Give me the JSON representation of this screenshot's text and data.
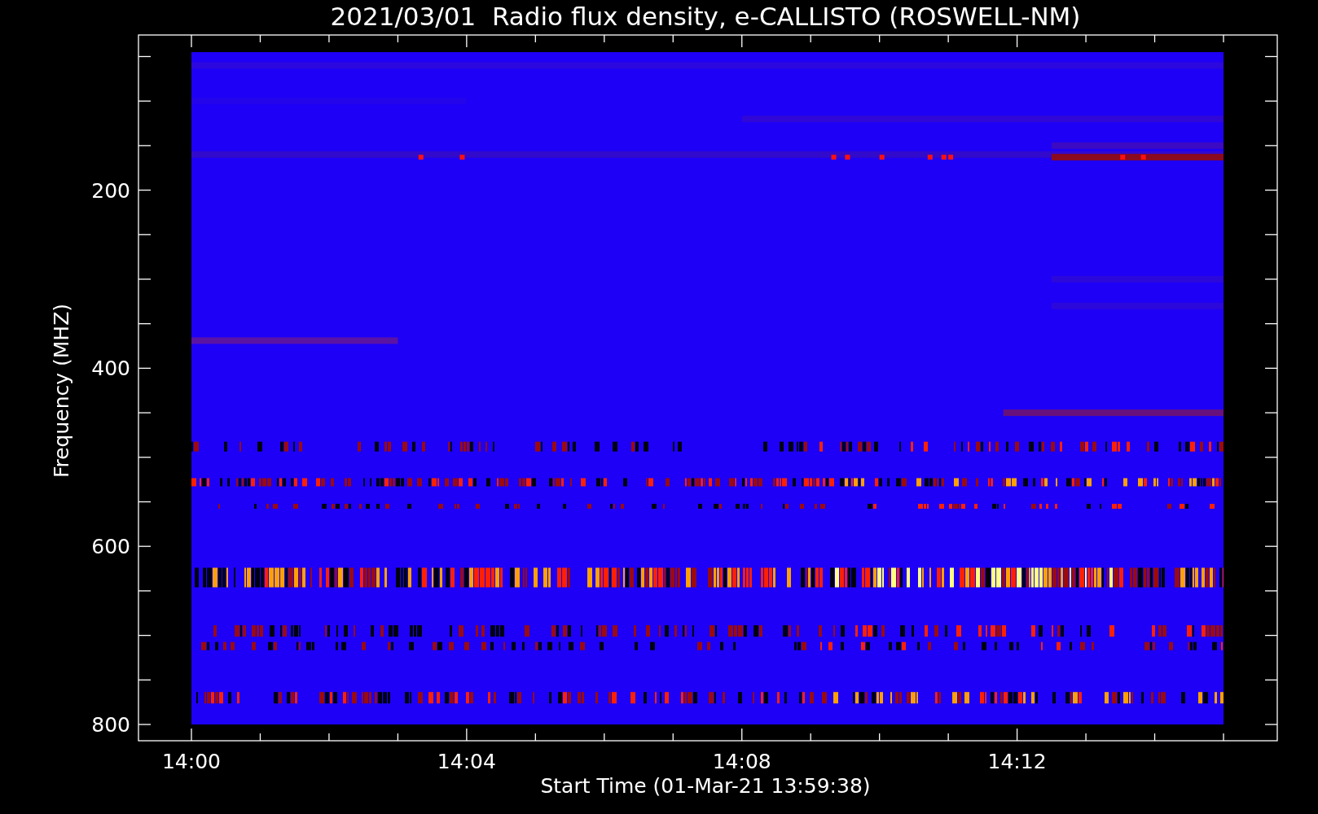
{
  "plot": {
    "title": "2021/03/01  Radio flux density, e-CALLISTO (ROSWELL-NM)",
    "y_axis": {
      "label": "Frequency (MHZ)",
      "tick_labels": [
        "200",
        "400",
        "600",
        "800"
      ]
    },
    "x_axis": {
      "label": "Start Time (01-Mar-21 13:59:38)",
      "tick_labels": [
        "14:00",
        "14:04",
        "14:08",
        "14:12"
      ]
    }
  }
}
